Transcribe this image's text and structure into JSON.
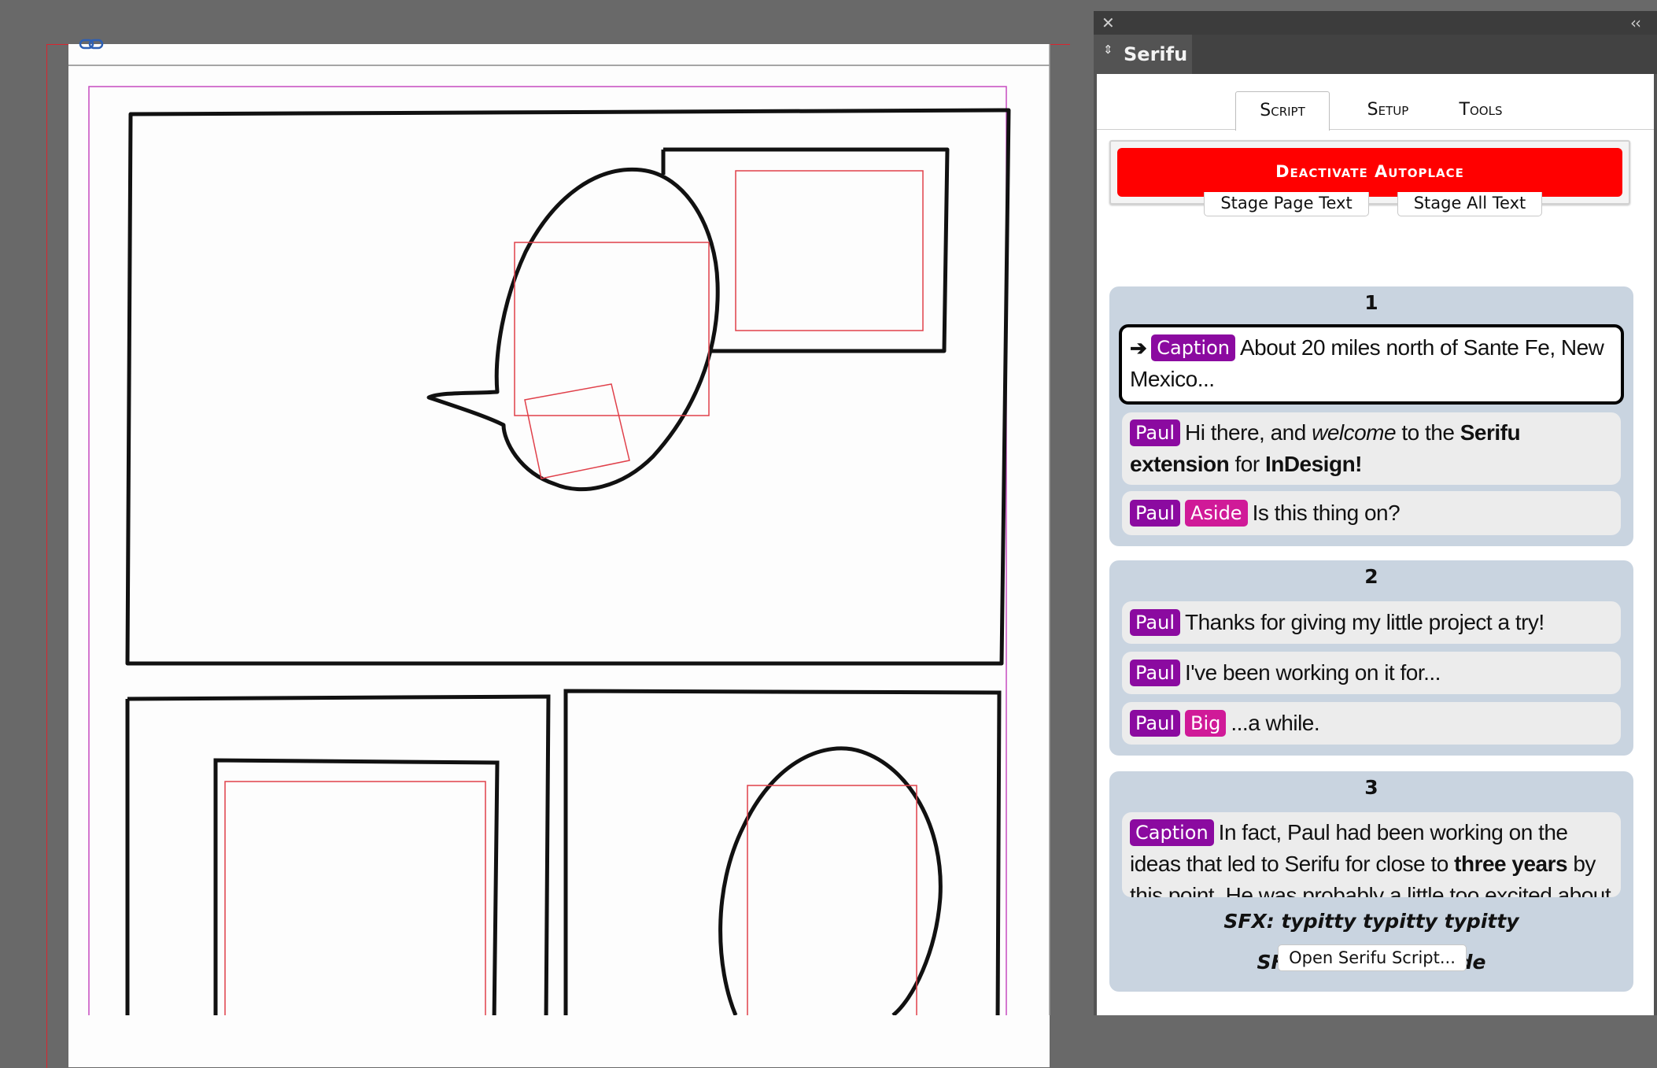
{
  "panel": {
    "title": "Serifu",
    "close_glyph": "✕",
    "collapse_glyph": "‹‹",
    "reorder_glyph": "⇕",
    "tabs": [
      "Script",
      "Setup",
      "Tools"
    ],
    "active_tab": "Script",
    "autoplace_label": "Deactivate Autoplace",
    "autoplace_color": "#ff0000",
    "stage_page_label": "Stage Page Text",
    "stage_all_label": "Stage All Text",
    "open_script_label": "Open Serifu Script...",
    "character_tag_color": "#8b0aa0",
    "style_tag_color": "#d01a98",
    "group_color": "#c9d4e0"
  },
  "script": {
    "groups": [
      {
        "number": "1",
        "lines": [
          {
            "current": true,
            "arrow": "➔",
            "tags": [
              "Caption"
            ],
            "styles": [],
            "text": "About 20 miles north of Sante Fe, New Mexico..."
          },
          {
            "current": false,
            "tags": [
              "Paul"
            ],
            "styles": [],
            "text_parts": [
              "Hi there, and ",
              "welcome",
              " to the ",
              "Serifu extension",
              " for ",
              "InDesign!"
            ]
          },
          {
            "current": false,
            "tags": [
              "Paul"
            ],
            "styles": [
              "Aside"
            ],
            "text": "Is this thing on?"
          }
        ]
      },
      {
        "number": "2",
        "lines": [
          {
            "tags": [
              "Paul"
            ],
            "styles": [],
            "text": "Thanks for giving my little project a try!"
          },
          {
            "tags": [
              "Paul"
            ],
            "styles": [],
            "text": "I've been working on it for..."
          },
          {
            "tags": [
              "Paul"
            ],
            "styles": [
              "Big"
            ],
            "text": "...a while."
          }
        ]
      },
      {
        "number": "3",
        "lines": [
          {
            "tags": [
              "Caption"
            ],
            "styles": [],
            "text_parts": [
              "In fact, Paul had been working on the ideas that led to Serifu for close to ",
              "three years",
              " by this point. He was probably a little too excited about showing it"
            ]
          }
        ],
        "sfx": [
          "SFX: typitty typitty typitty",
          "SFX: code code code"
        ]
      }
    ]
  }
}
